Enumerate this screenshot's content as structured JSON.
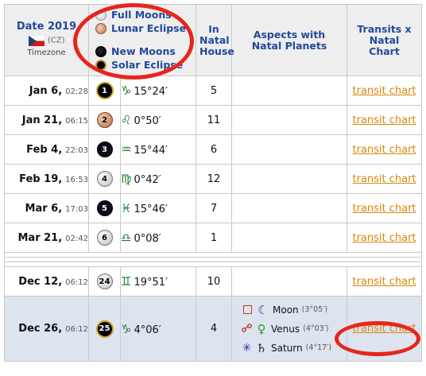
{
  "header": {
    "date_title": "Date 2019",
    "country_code": "(CZ)",
    "timezone": "Timezone",
    "legend": [
      "Full Moons",
      "Lunar Eclipse",
      "New Moons",
      "Solar Eclipse"
    ],
    "house_label": "In Natal House",
    "aspects_label": "Aspects with Natal Planets",
    "transits_label": "Transits x Natal Chart"
  },
  "colors": {
    "accent": "#22499c",
    "link": "#d8860b",
    "highlight_row": "#dde4ef",
    "annotation": "#e8251c",
    "sign": "#1e7b2f"
  },
  "rows": [
    {
      "date": "Jan 6,",
      "time": "02:28",
      "phase": "solar",
      "num": "1",
      "sign": "♑",
      "pos": "15°24′",
      "house": "5",
      "link": "transit chart"
    },
    {
      "date": "Jan 21,",
      "time": "06:15",
      "phase": "lunar",
      "num": "2",
      "sign": "♌",
      "pos": "0°50′",
      "house": "11",
      "link": "transit chart"
    },
    {
      "date": "Feb 4,",
      "time": "22:03",
      "phase": "new",
      "num": "3",
      "sign": "♒",
      "pos": "15°44′",
      "house": "6",
      "link": "transit chart"
    },
    {
      "date": "Feb 19,",
      "time": "16:53",
      "phase": "full",
      "num": "4",
      "sign": "♍",
      "pos": "0°42′",
      "house": "12",
      "link": "transit chart"
    },
    {
      "date": "Mar 6,",
      "time": "17:03",
      "phase": "new",
      "num": "5",
      "sign": "♓",
      "pos": "15°46′",
      "house": "7",
      "link": "transit chart"
    },
    {
      "date": "Mar 21,",
      "time": "02:42",
      "phase": "full",
      "num": "6",
      "sign": "♎",
      "pos": "0°08′",
      "house": "1",
      "link": "transit chart"
    }
  ],
  "rows2": [
    {
      "date": "Dec 12,",
      "time": "06:12",
      "phase": "full",
      "num": "24",
      "sign": "♊",
      "pos": "19°51′",
      "house": "10",
      "link": "transit chart"
    }
  ],
  "last_row": {
    "date": "Dec 26,",
    "time": "06:12",
    "phase": "solar",
    "num": "25",
    "sign": "♑",
    "pos": "4°06′",
    "house": "4",
    "link": "transit chart",
    "aspects": [
      {
        "aspect_icon": "square-aspect-icon",
        "planet_glyph": "☾",
        "planet": "Moon",
        "orb": "(3°05′)"
      },
      {
        "aspect_icon": "opposition-aspect-icon",
        "planet_glyph": "♀",
        "planet": "Venus",
        "orb": "(4°03′)"
      },
      {
        "aspect_icon": "sextile-aspect-icon",
        "planet_glyph": "♄",
        "planet": "Saturn",
        "orb": "(4°17′)"
      }
    ]
  }
}
